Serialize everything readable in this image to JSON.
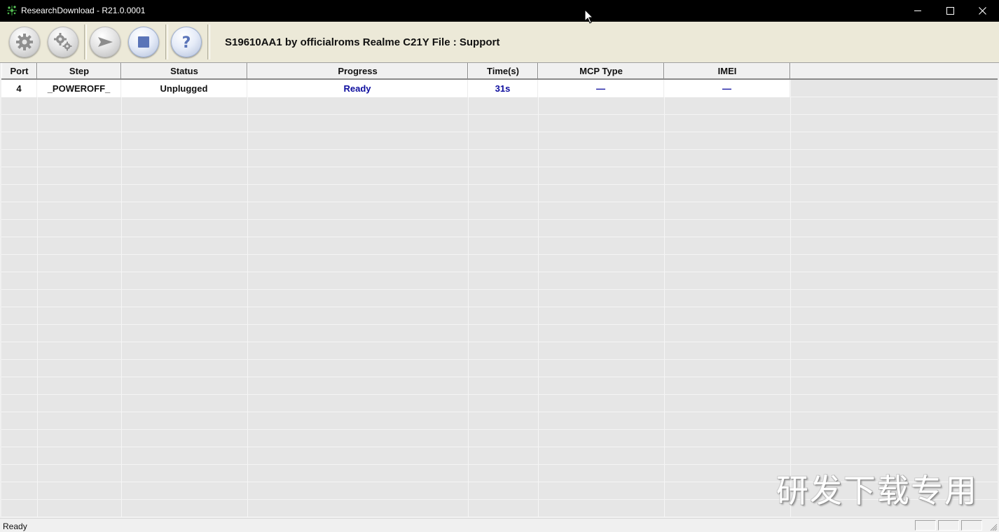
{
  "window": {
    "title": "ResearchDownload - R21.0.0001"
  },
  "toolbar": {
    "buttons": [
      {
        "name": "load-packet",
        "icon": "gear-icon"
      },
      {
        "name": "settings",
        "icon": "gears-icon"
      },
      {
        "name": "start-download",
        "icon": "play-arrow-icon"
      },
      {
        "name": "stop-download",
        "icon": "stop-square-icon"
      },
      {
        "name": "help",
        "icon": "question-icon"
      }
    ],
    "title": "S19610AA1 by officialroms Realme C21Y File : Support"
  },
  "grid": {
    "columns": [
      "Port",
      "Step",
      "Status",
      "Progress",
      "Time(s)",
      "MCP Type",
      "IMEI"
    ],
    "rows": [
      [
        "4",
        "_POWEROFF_",
        "Unplugged",
        "Ready",
        "31s",
        "—",
        "—"
      ]
    ]
  },
  "watermark": "研发下载专用",
  "statusbar": {
    "text": "Ready"
  },
  "colors": {
    "titlebar": "#000000",
    "toolbar": "#ece9d8",
    "progress_text": "#0d0d9e"
  }
}
